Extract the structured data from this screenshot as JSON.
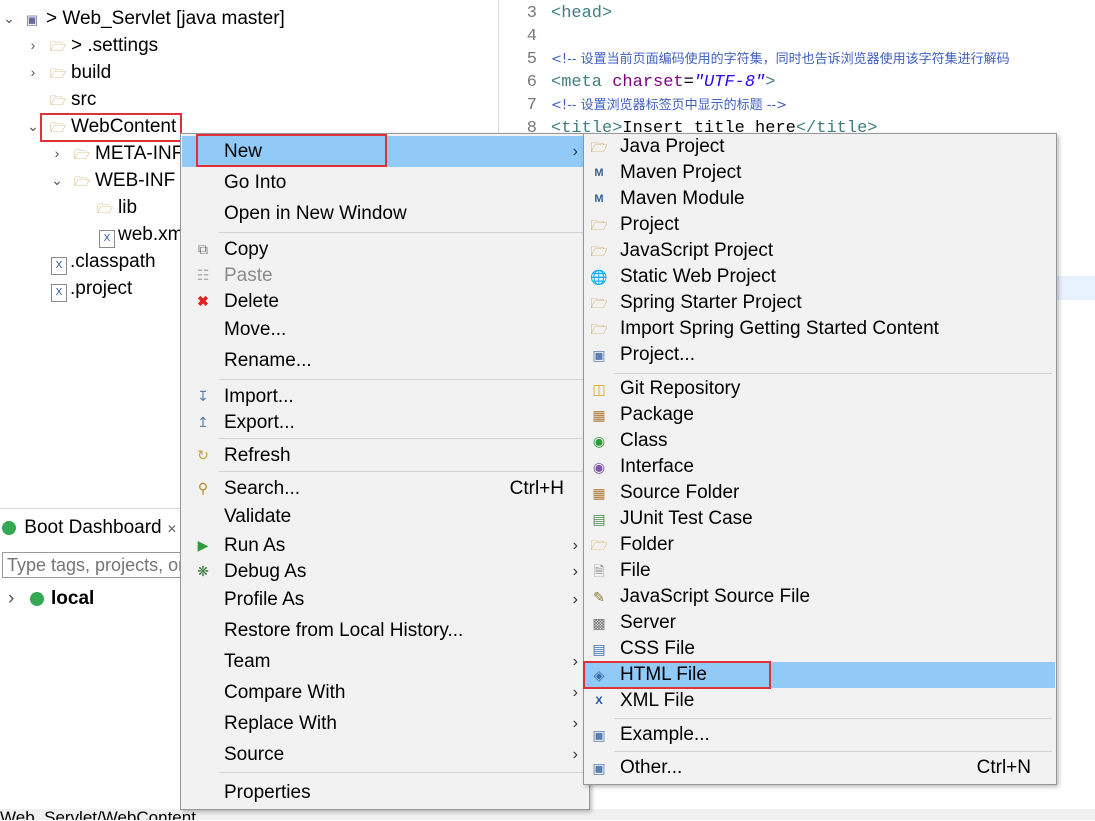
{
  "tree": {
    "project": "> Web_Servlet [java master]",
    "items": [
      {
        "label": "> .settings"
      },
      {
        "label": "build"
      },
      {
        "label": "src"
      },
      {
        "label": "WebContent"
      },
      {
        "label": "META-INF"
      },
      {
        "label": "WEB-INF"
      },
      {
        "label": "lib"
      },
      {
        "label": "web.xml"
      },
      {
        "label": ".classpath"
      },
      {
        "label": ".project"
      }
    ]
  },
  "editor": {
    "lines": [
      {
        "num": "3",
        "tag": "<head>"
      },
      {
        "num": "4"
      },
      {
        "num": "5",
        "comment": "<!-- 设置当前页面编码使用的字符集，同时也告诉浏览器使用该字符集进行解码"
      },
      {
        "num": "6",
        "tag_open": "<meta ",
        "attr": "charset",
        "eq": "=",
        "value": "\"UTF-8\"",
        "tag_close": ">"
      },
      {
        "num": "7",
        "comment": "<!-- 设置浏览器标签页中显示的标题 -->"
      },
      {
        "num": "8",
        "tag_open": "<title>",
        "text": "Insert title here",
        "tag_close": "</title>"
      }
    ]
  },
  "boot_dashboard": {
    "title": "Boot Dashboard",
    "filter_placeholder": "Type tags, projects, or",
    "local": "local"
  },
  "status_bar": {
    "text": "Web_Servlet/WebContent"
  },
  "context_menu": {
    "items": [
      {
        "label": "New"
      },
      {
        "label": "Go Into"
      },
      {
        "label": "Open in New Window"
      },
      {
        "label": "Copy"
      },
      {
        "label": "Paste"
      },
      {
        "label": "Delete"
      },
      {
        "label": "Move..."
      },
      {
        "label": "Rename..."
      },
      {
        "label": "Import..."
      },
      {
        "label": "Export..."
      },
      {
        "label": "Refresh"
      },
      {
        "label": "Search...",
        "shortcut": "Ctrl+H"
      },
      {
        "label": "Validate"
      },
      {
        "label": "Run As"
      },
      {
        "label": "Debug As"
      },
      {
        "label": "Profile As"
      },
      {
        "label": "Restore from Local History..."
      },
      {
        "label": "Team"
      },
      {
        "label": "Compare With"
      },
      {
        "label": "Replace With"
      },
      {
        "label": "Source"
      },
      {
        "label": "Properties"
      }
    ]
  },
  "new_submenu": {
    "items": [
      {
        "label": "Java Project"
      },
      {
        "label": "Maven Project"
      },
      {
        "label": "Maven Module"
      },
      {
        "label": "Project"
      },
      {
        "label": "JavaScript Project"
      },
      {
        "label": "Static Web Project"
      },
      {
        "label": "Spring Starter Project"
      },
      {
        "label": "Import Spring Getting Started Content"
      },
      {
        "label": "Project..."
      },
      {
        "label": "Git Repository"
      },
      {
        "label": "Package"
      },
      {
        "label": "Class"
      },
      {
        "label": "Interface"
      },
      {
        "label": "Source Folder"
      },
      {
        "label": "JUnit Test Case"
      },
      {
        "label": "Folder"
      },
      {
        "label": "File"
      },
      {
        "label": "JavaScript Source File"
      },
      {
        "label": "Server"
      },
      {
        "label": "CSS File"
      },
      {
        "label": "HTML File"
      },
      {
        "label": "XML File"
      },
      {
        "label": "Example..."
      },
      {
        "label": "Other...",
        "shortcut": "Ctrl+N"
      }
    ]
  },
  "colors": {
    "highlight": "#91c9f7",
    "red_box": "#e0303a",
    "menu_bg": "#f2f2f2"
  }
}
